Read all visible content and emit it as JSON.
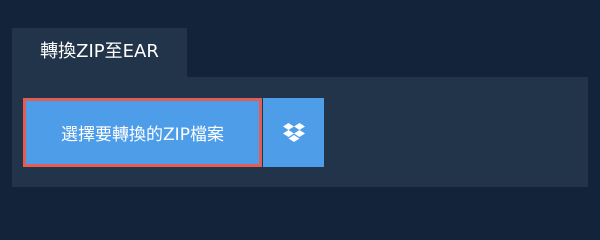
{
  "tab": {
    "label": "轉換ZIP至EAR"
  },
  "actions": {
    "choose_file_label": "選擇要轉換的ZIP檔案",
    "cloud_icon": "dropbox-icon"
  },
  "colors": {
    "background": "#13243a",
    "panel": "#223449",
    "button": "#4e9de9",
    "focus_border": "#e45c56"
  }
}
